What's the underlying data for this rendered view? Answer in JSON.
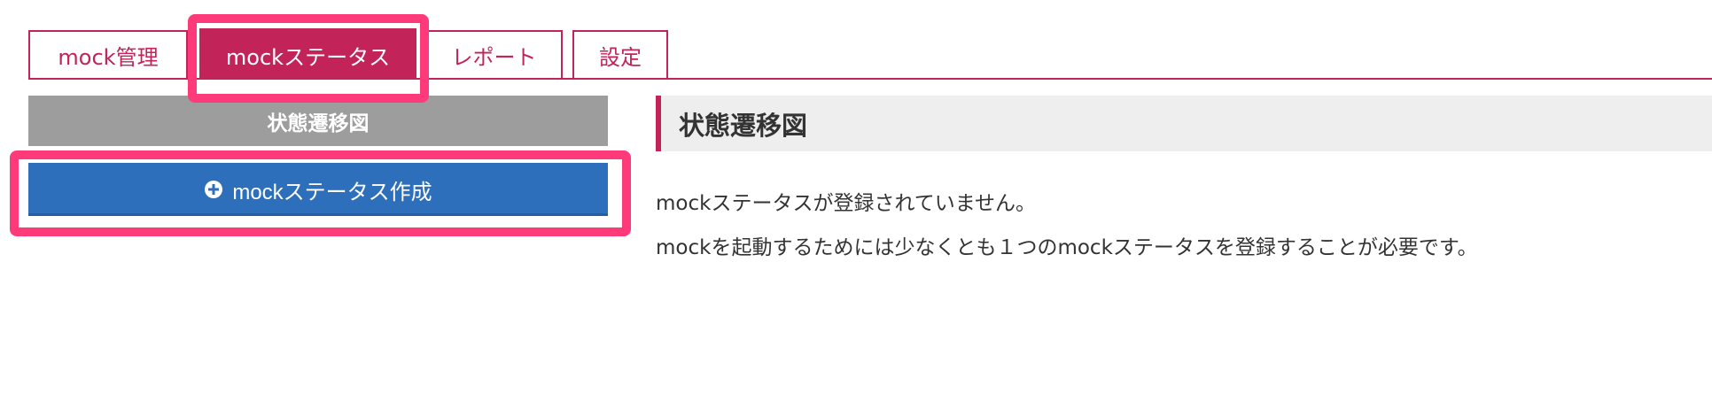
{
  "tabs": [
    {
      "label": "mock管理",
      "active": false
    },
    {
      "label": "mockステータス",
      "active": true
    },
    {
      "label": "レポート",
      "active": false
    },
    {
      "label": "設定",
      "active": false
    }
  ],
  "sidebar": {
    "header": "状態遷移図",
    "create_button": {
      "label": "mockステータス作成",
      "icon": "plus-circle-icon"
    }
  },
  "main": {
    "title": "状態遷移図",
    "messages": [
      "mockステータスが登録されていません。",
      "mockを起動するためには少なくとも１つのmockステータスを登録することが必要です。"
    ]
  },
  "colors": {
    "accent": "#c2245a",
    "primary_button": "#2e6fbc",
    "sidebar_header": "#9d9d9d",
    "highlight": "#ff3a7a"
  }
}
